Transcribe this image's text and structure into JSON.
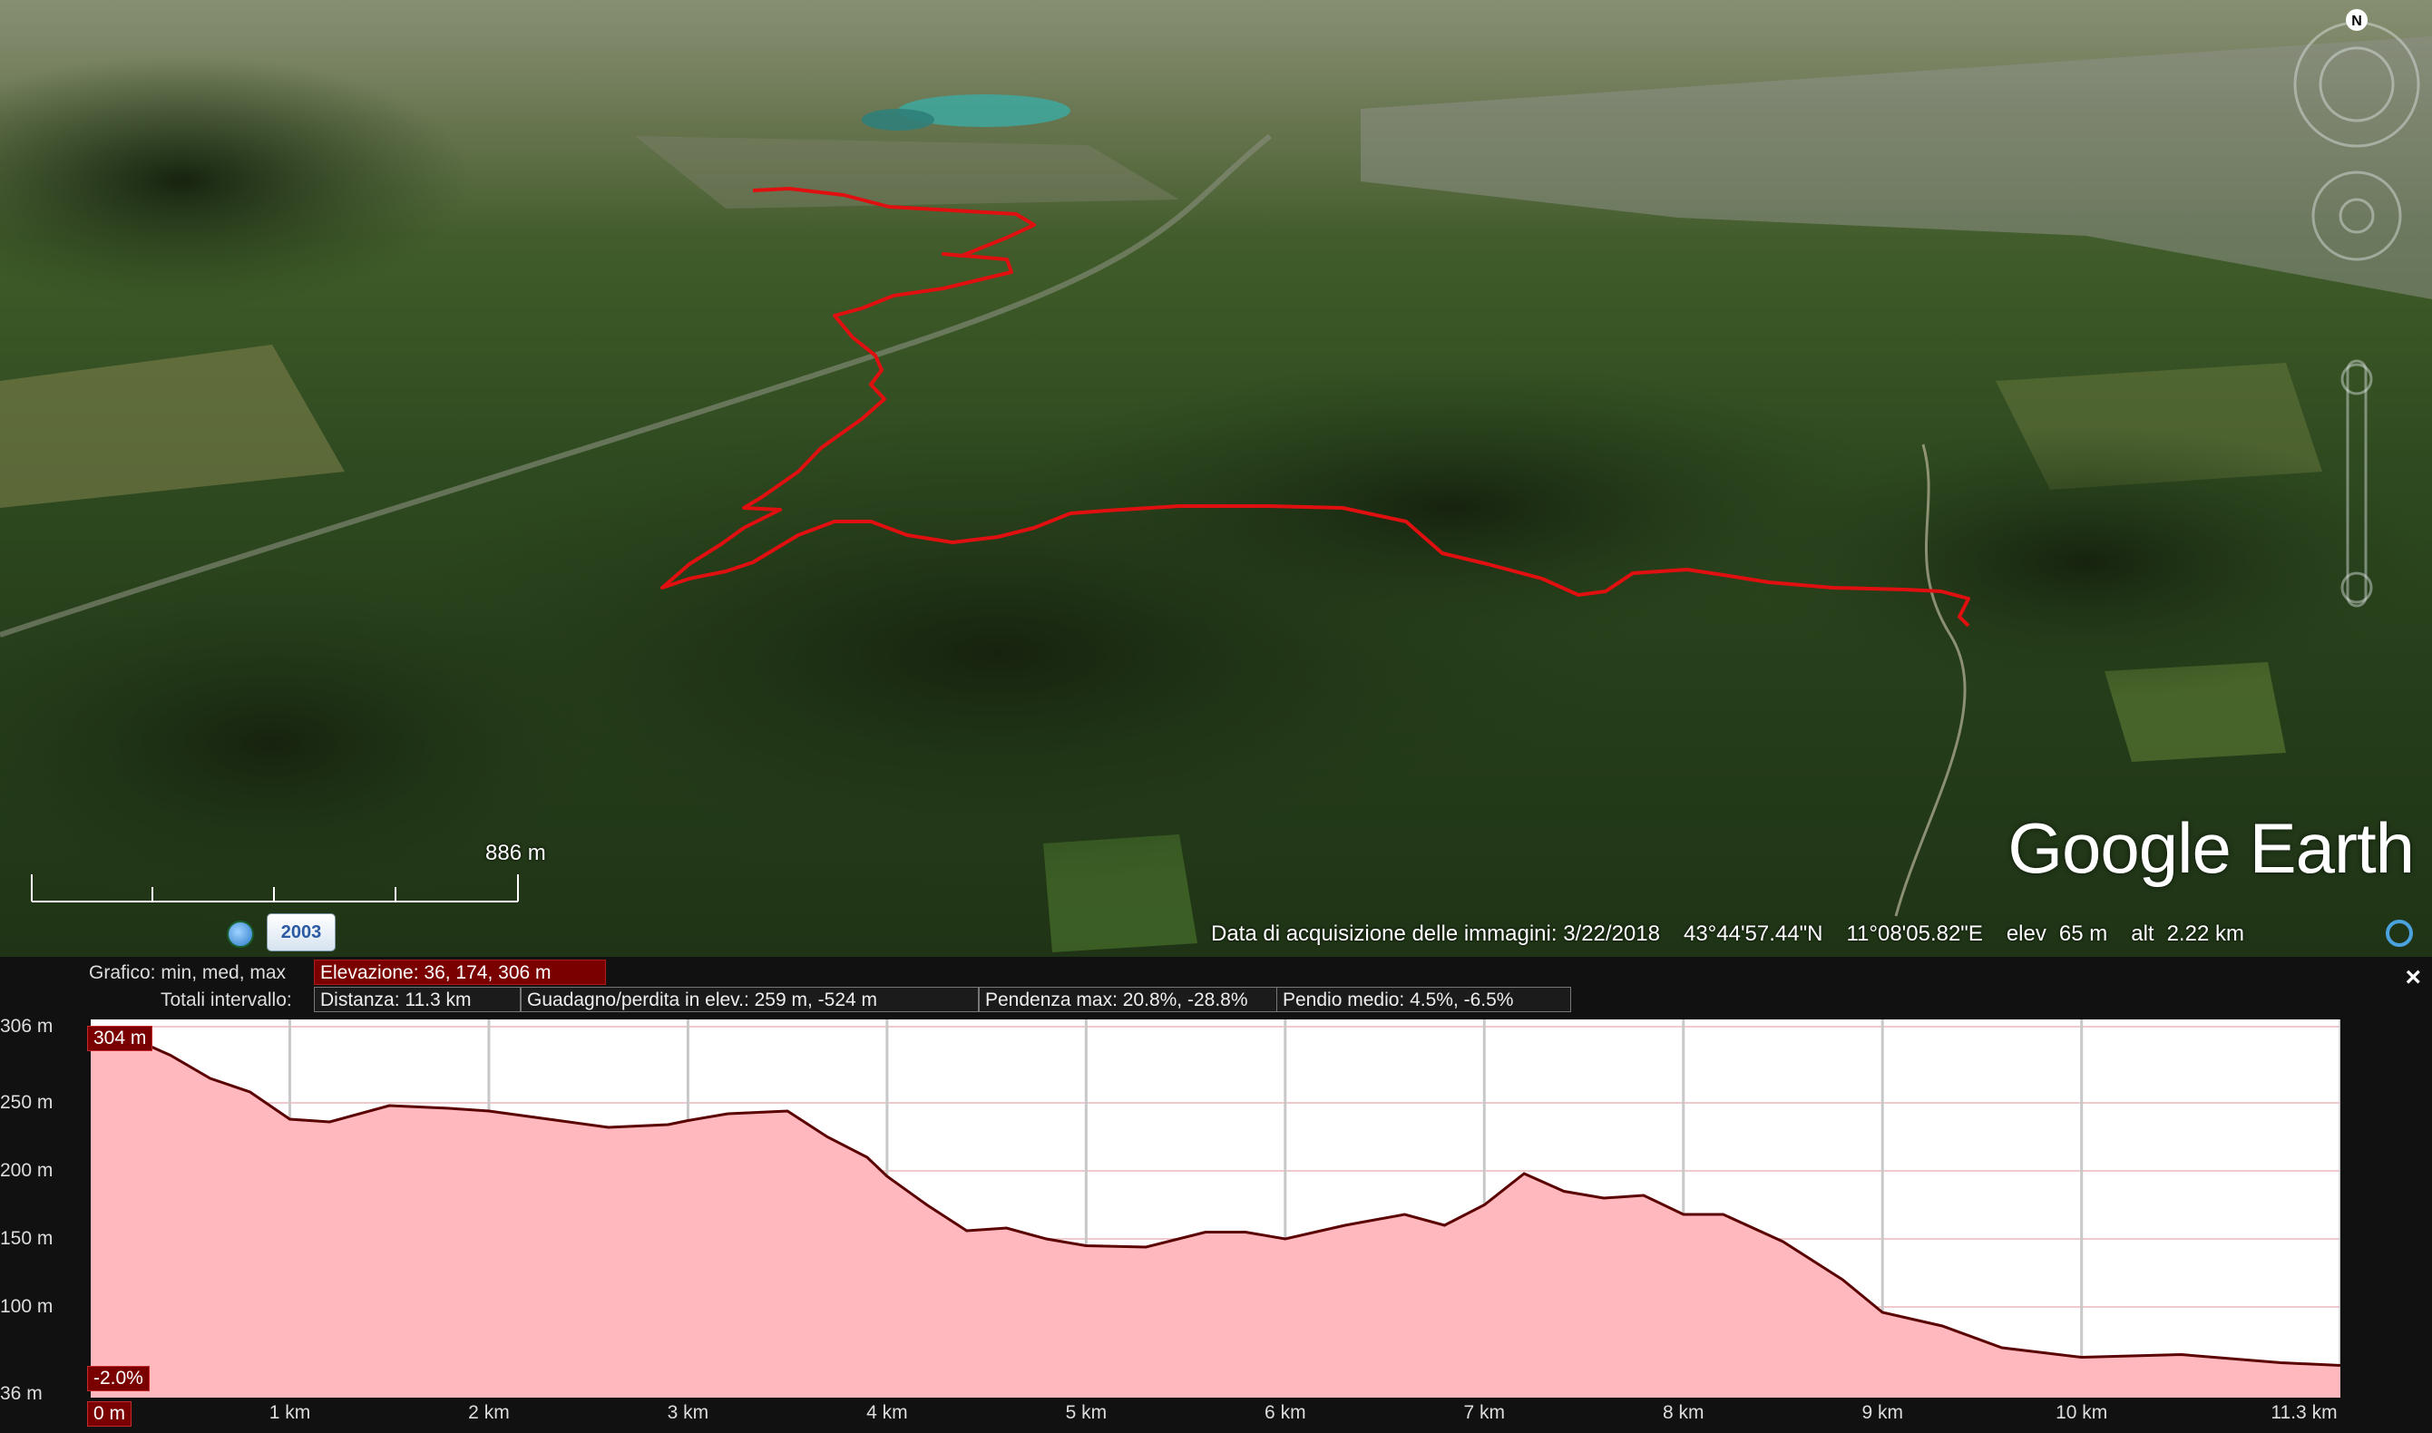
{
  "map": {
    "watermark": {
      "brand1": "Google",
      "brand2": "Earth"
    },
    "scale_label": "886 m",
    "historical_imagery_year": "2003",
    "status": {
      "imagery_date": "Data di acquisizione delle immagini: 3/22/2018",
      "lat": "43°44'57.44\"N",
      "lon": "11°08'05.82\"E",
      "elev_label": "elev",
      "elev_value": "65 m",
      "alt_label": "alt",
      "alt_value": "2.22 km"
    },
    "compass_north": "N",
    "route_color": "#e01010"
  },
  "elevation_panel": {
    "close_label": "×",
    "row1_label": "Grafico: min, med, max",
    "row1_value": "Elevazione: 36, 174, 306 m",
    "row2_label": "Totali intervallo:",
    "distance": "Distanza: 11.3 km",
    "gain_loss": "Guadagno/perdita in elev.: 259 m, -524 m",
    "max_slope": "Pendenza max: 20.8%, -28.8%",
    "avg_slope": "Pendio medio: 4.5%, -6.5%",
    "cursor_elev": "304 m",
    "cursor_slope": "-2.0%",
    "cursor_dist": "0 m",
    "fill_color": "#ffb8bd",
    "line_color": "#5a0000"
  },
  "chart_data": {
    "type": "area",
    "xlabel": "",
    "ylabel": "",
    "x_unit": "km",
    "y_unit": "m",
    "xlim": [
      0,
      11.3
    ],
    "ylim": [
      36,
      306
    ],
    "y_ticks": [
      "306 m",
      "250 m",
      "200 m",
      "150 m",
      "100 m",
      "36 m"
    ],
    "y_tick_values": [
      306,
      250,
      200,
      150,
      100,
      36
    ],
    "x_ticks": [
      "1 km",
      "2 km",
      "3 km",
      "4 km",
      "5 km",
      "6 km",
      "7 km",
      "8 km",
      "9 km",
      "10 km",
      "11.3 km"
    ],
    "x_tick_values": [
      1,
      2,
      3,
      4,
      5,
      6,
      7,
      8,
      9,
      10,
      11.3
    ],
    "grid": true,
    "series": [
      {
        "x": [
          0,
          0.2,
          0.4,
          0.6,
          0.8,
          1.0,
          1.2,
          1.5,
          1.8,
          2.0,
          2.3,
          2.6,
          2.9,
          3.0,
          3.2,
          3.5,
          3.7,
          3.9,
          4.0,
          4.2,
          4.4,
          4.6,
          4.8,
          5.0,
          5.3,
          5.6,
          5.8,
          6.0,
          6.3,
          6.6,
          6.8,
          7.0,
          7.2,
          7.4,
          7.6,
          7.8,
          8.0,
          8.2,
          8.5,
          8.8,
          9.0,
          9.3,
          9.6,
          10.0,
          10.5,
          11.0,
          11.3
        ],
        "y": [
          304,
          298,
          285,
          268,
          258,
          238,
          236,
          248,
          246,
          244,
          238,
          232,
          234,
          237,
          242,
          244,
          225,
          210,
          196,
          175,
          156,
          158,
          150,
          145,
          144,
          155,
          155,
          150,
          160,
          168,
          160,
          175,
          198,
          185,
          180,
          182,
          168,
          168,
          148,
          120,
          96,
          86,
          70,
          63,
          65,
          59,
          57
        ]
      }
    ]
  }
}
